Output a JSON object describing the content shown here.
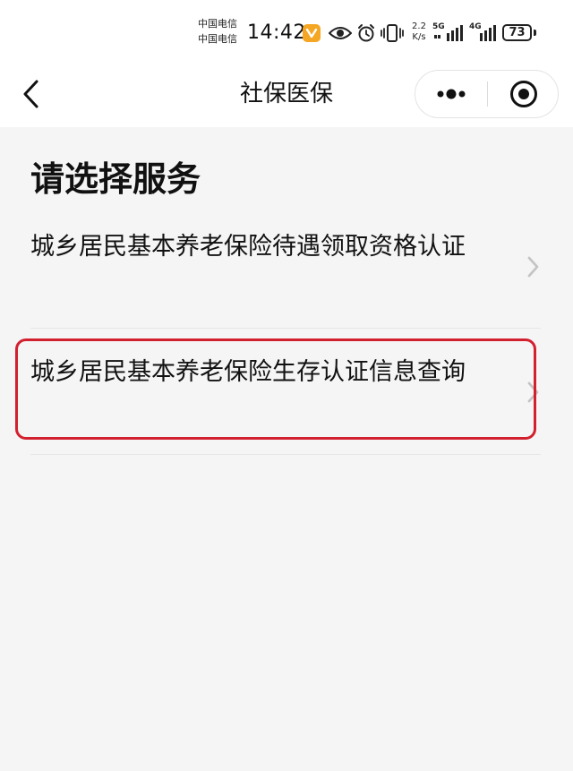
{
  "status_bar": {
    "carrier_1": "中国电信",
    "carrier_2": "中国电信",
    "time": "14:42",
    "speed_value": "2.2",
    "speed_unit": "K/s",
    "signal_1_label": "5G",
    "signal_2_label": "4G",
    "battery": "73"
  },
  "nav": {
    "title": "社保医保"
  },
  "content": {
    "heading": "请选择服务",
    "services": [
      {
        "label": "城乡居民基本养老保险待遇领取资格认证"
      },
      {
        "label": "城乡居民基本养老保险生存认证信息查询"
      }
    ]
  },
  "colors": {
    "highlight": "#d3202f",
    "background": "#f5f5f5",
    "header_background": "#ffffff",
    "chevron": "#c4c4c4"
  }
}
